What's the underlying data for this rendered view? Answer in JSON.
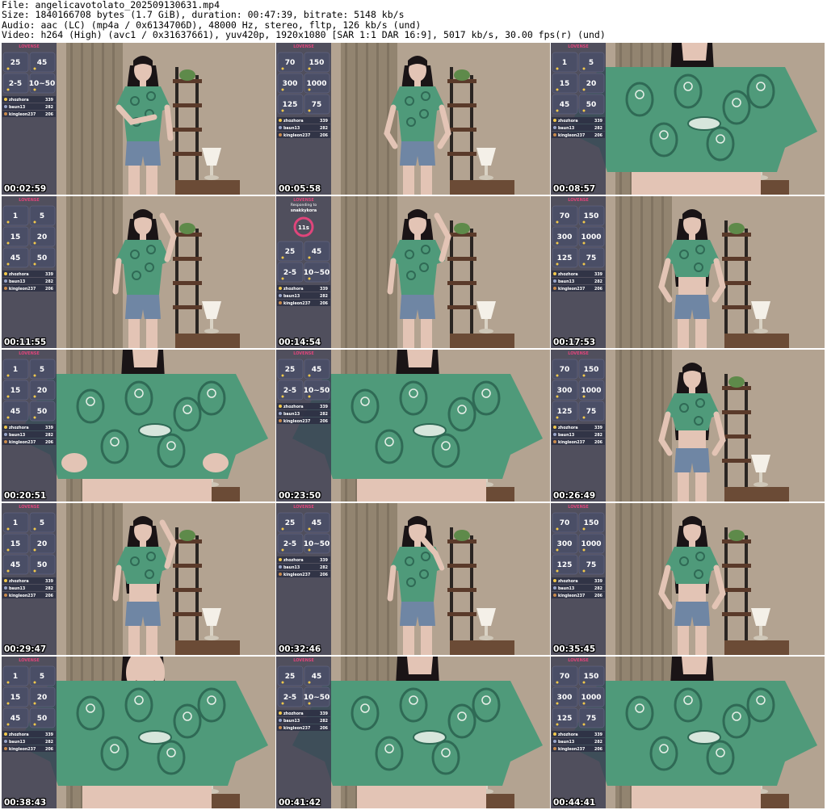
{
  "header": {
    "file_line": "File: angelicavotolato_202509130631.mp4",
    "size_line": "Size: 1840166708 bytes (1.7 GiB), duration: 00:47:39, bitrate: 5148 kb/s",
    "audio_line": "Audio: aac (LC) (mp4a / 0x6134706D), 48000 Hz, stereo, fltp, 126 kb/s (und)",
    "video_line": "Video: h264 (High) (avc1 / 0x31637661), yuv420p, 1920x1080 [SAR 1:1 DAR 16:9], 5017 kb/s, 30.00 fps(r) (und)"
  },
  "overlay": {
    "brand": "LOVENSE",
    "tipper_names": [
      "zhozhora",
      "baun13",
      "kingleon237"
    ],
    "tipper_values": [
      "339",
      "282",
      "206"
    ],
    "panel_a": [
      "70",
      "150",
      "300",
      "1000",
      "125",
      "75"
    ],
    "panel_b": [
      "1",
      "5",
      "15",
      "20",
      "45",
      "50"
    ],
    "panel_c": [
      "25",
      "45",
      "2-5",
      "10~50"
    ],
    "responding_label": "Responding to",
    "responding_user": "snakkykora",
    "timer_value": "11s"
  },
  "thumbnails": [
    {
      "timestamp": "00:02:59",
      "layout": "full",
      "panel": "c",
      "pose": "arms-folded"
    },
    {
      "timestamp": "00:05:58",
      "layout": "full",
      "panel": "a",
      "pose": "hand-on-hip"
    },
    {
      "timestamp": "00:08:57",
      "layout": "closeup",
      "panel": "b",
      "pose": "hand-on-chest"
    },
    {
      "timestamp": "00:11:55",
      "layout": "full",
      "panel": "b",
      "pose": "hand-on-head"
    },
    {
      "timestamp": "00:14:54",
      "layout": "full",
      "panel": "c",
      "pose": "hand-on-head",
      "responding": true
    },
    {
      "timestamp": "00:17:53",
      "layout": "full",
      "panel": "a",
      "pose": "crop-top"
    },
    {
      "timestamp": "00:20:51",
      "layout": "closeup",
      "panel": "b",
      "pose": "lifting-shirt"
    },
    {
      "timestamp": "00:23:50",
      "layout": "closeup",
      "panel": "c",
      "pose": "standing"
    },
    {
      "timestamp": "00:26:49",
      "layout": "full",
      "panel": "a",
      "pose": "crop-top"
    },
    {
      "timestamp": "00:29:47",
      "layout": "full",
      "panel": "b",
      "pose": "hand-on-head"
    },
    {
      "timestamp": "00:32:46",
      "layout": "full",
      "panel": "c",
      "pose": "hand-at-mouth"
    },
    {
      "timestamp": "00:35:45",
      "layout": "full",
      "panel": "a",
      "pose": "crop-top"
    },
    {
      "timestamp": "00:38:43",
      "layout": "closeup",
      "panel": "b",
      "pose": "smiling"
    },
    {
      "timestamp": "00:41:42",
      "layout": "closeup",
      "panel": "c",
      "pose": "standing"
    },
    {
      "timestamp": "00:44:41",
      "layout": "closeup",
      "panel": "a",
      "pose": "standing"
    }
  ],
  "colors": {
    "wall": "#b3a391",
    "curtain": "#8a7c68",
    "shirt": "#4f9a7a",
    "shirt_dark": "#2f6a55",
    "hair": "#1a1416",
    "skin": "#e3c4b5",
    "denim": "#6f86a4",
    "shelf": "#2a2522",
    "lamp": "#f4f0e8",
    "overlay_bg": "#3a3d52",
    "overlay_accent": "#e0457b"
  }
}
